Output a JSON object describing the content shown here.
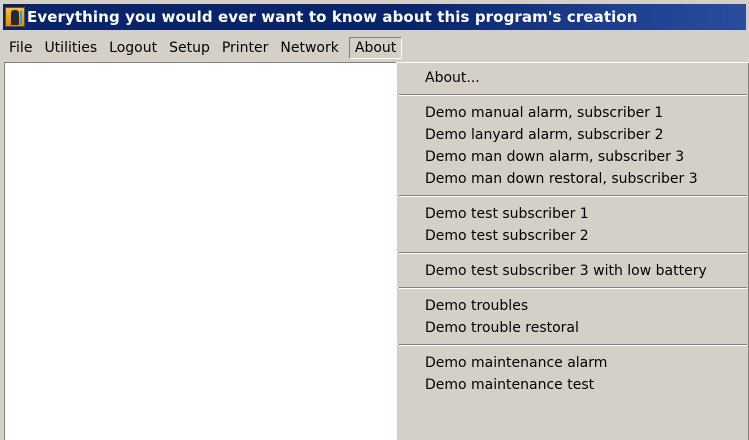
{
  "window": {
    "title": "Everything you would ever want to know about this program's creation",
    "icon": "app-door-icon"
  },
  "menubar": {
    "items": [
      "File",
      "Utilities",
      "Logout",
      "Setup",
      "Printer",
      "Network",
      "About"
    ],
    "open_menu": "About"
  },
  "about_menu": {
    "groups": [
      [
        "About..."
      ],
      [
        "Demo manual alarm, subscriber 1",
        "Demo lanyard alarm, subscriber 2",
        "Demo man down alarm, subscriber 3",
        "Demo man down restoral, subscriber 3"
      ],
      [
        "Demo test subscriber 1",
        "Demo test subscriber 2"
      ],
      [
        "Demo test subscriber 3 with low battery"
      ],
      [
        "Demo troubles",
        "Demo trouble restoral"
      ],
      [
        "Demo maintenance alarm",
        "Demo maintenance test"
      ]
    ]
  },
  "colors": {
    "titlebar": "#0a246a",
    "face": "#d4d0c8",
    "client": "#ffffff"
  }
}
